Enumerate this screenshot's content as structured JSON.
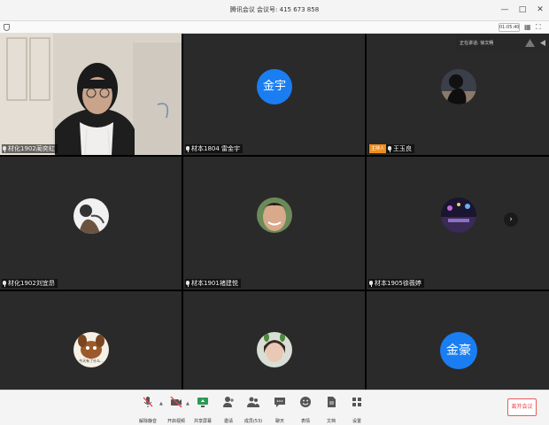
{
  "window": {
    "title": "腾讯会议 会议号: 415 673 858"
  },
  "subbar": {
    "timer": "01:05:40"
  },
  "speaking": {
    "text": "正在讲话: 徐文畅"
  },
  "participants": [
    {
      "name": "材化1902蔺奕虹",
      "type": "video"
    },
    {
      "name": "材本1804 雷金宇",
      "type": "text-avatar",
      "avatar_text": "金宇"
    },
    {
      "name": "王玉良",
      "type": "image-avatar",
      "badge": "主持人"
    },
    {
      "name": "材化1902刘宜昂",
      "type": "image-avatar"
    },
    {
      "name": "材本1901褚建悦",
      "type": "image-avatar"
    },
    {
      "name": "材本1905徐薇婷",
      "type": "image-avatar"
    },
    {
      "name": "",
      "type": "image-avatar",
      "avatar_caption": "今天有了什么..."
    },
    {
      "name": "",
      "type": "image-avatar"
    },
    {
      "name": "",
      "type": "text-avatar",
      "avatar_text": "金豪"
    }
  ],
  "toolbar": {
    "items": [
      {
        "label": "解除静音",
        "icon": "mic-muted-icon"
      },
      {
        "label": "开启视频",
        "icon": "camera-off-icon"
      },
      {
        "label": "共享屏幕",
        "icon": "share-screen-icon"
      },
      {
        "label": "邀请",
        "icon": "invite-icon"
      },
      {
        "label": "成员(53)",
        "icon": "members-icon"
      },
      {
        "label": "聊天",
        "icon": "chat-icon"
      },
      {
        "label": "表情",
        "icon": "emoji-icon"
      },
      {
        "label": "文档",
        "icon": "document-icon"
      },
      {
        "label": "设置",
        "icon": "settings-icon"
      }
    ],
    "leave_label": "离开会议"
  },
  "colors": {
    "accent_blue": "#1a7ef2",
    "host_badge": "#f08c1a",
    "leave_red": "#e04a4a"
  }
}
